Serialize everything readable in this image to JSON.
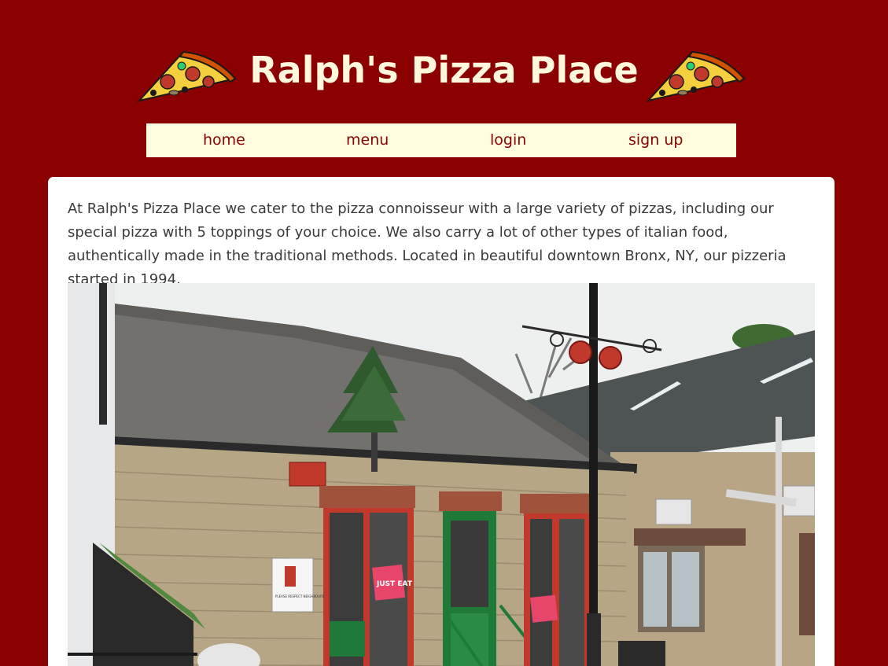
{
  "header": {
    "title": "Ralph's Pizza Place",
    "left_icon": "pizza-slice-icon",
    "right_icon": "pizza-slice-icon"
  },
  "nav": {
    "items": [
      {
        "label": "home"
      },
      {
        "label": "menu"
      },
      {
        "label": "login"
      },
      {
        "label": "sign up"
      }
    ]
  },
  "main": {
    "intro": "At Ralph's Pizza Place we cater to the pizza connoisseur with a large variety of pizzas, including our special pizza with 5 toppings of your choice. We also carry a lot of other types of italian food, authentically made in the traditional methods. Located in beautiful downtown Bronx, NY, our pizzeria started in 1994.",
    "photo_text": {
      "shop_sign": "JUST EAT",
      "bin_sign": "PLEASE RESPECT NEIGHBOURS"
    }
  },
  "colors": {
    "background": "#8b0000",
    "title": "#fff8dc",
    "nav_bg": "#fffde0",
    "nav_text": "#8b0000"
  }
}
